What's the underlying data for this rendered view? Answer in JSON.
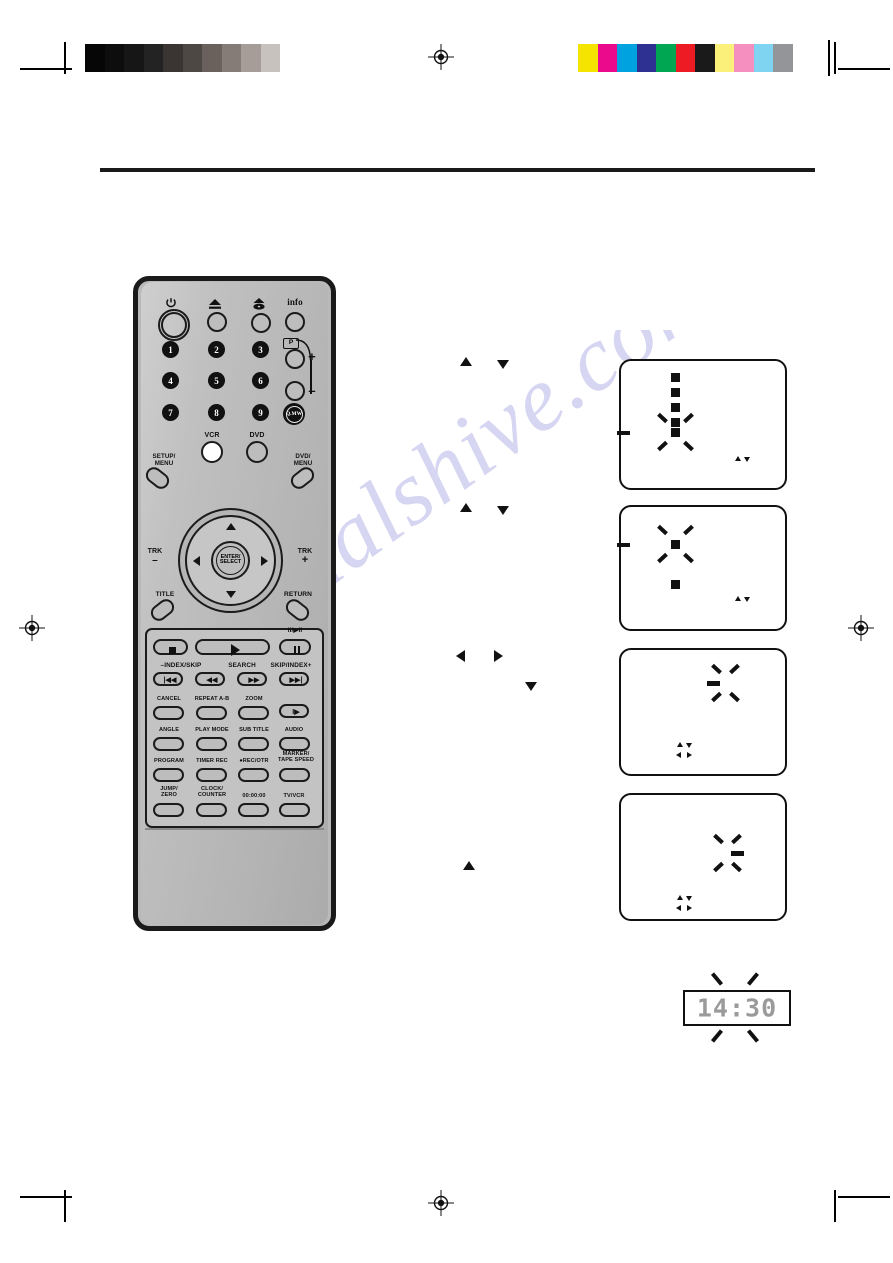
{
  "page": {
    "type": "scanned-manual-page",
    "watermark": "manualshive.com",
    "header_rule": true
  },
  "print_marks": {
    "grayscale_bar": [
      "#060606",
      "#0d0d0d",
      "#161616",
      "#232323",
      "#3a3533",
      "#4e4845",
      "#6a615c",
      "#867c77",
      "#a79d98",
      "#c8c2be",
      "#ffffff"
    ],
    "color_bar": [
      "#f5e400",
      "#ec0a8c",
      "#00a3e0",
      "#2e3192",
      "#00a651",
      "#ed1c24",
      "#1a1a1a",
      "#faf07a",
      "#f48fc0",
      "#7fd4f2",
      "#939598"
    ]
  },
  "remote": {
    "top_row": [
      {
        "name": "power",
        "icon": "power-icon",
        "label": ""
      },
      {
        "name": "vcr-eject",
        "icon": "eject-icon",
        "label": ""
      },
      {
        "name": "dvd-eject",
        "icon": "disc-eject-icon",
        "label": ""
      },
      {
        "name": "info",
        "icon": "",
        "label": "info"
      }
    ],
    "numbers": [
      "1",
      "2",
      "3",
      "4",
      "5",
      "6",
      "7",
      "8",
      "9"
    ],
    "channel": {
      "marker": "P",
      "plus": "+",
      "minus": "–"
    },
    "qmw_label": "Q.MW",
    "source_buttons": [
      {
        "name": "vcr",
        "label": "VCR"
      },
      {
        "name": "dvd",
        "label": "DVD"
      }
    ],
    "menu_buttons": [
      {
        "name": "setup-menu",
        "label": "SETUP/\nMENU"
      },
      {
        "name": "dvd-menu",
        "label": "DVD/\nMENU"
      },
      {
        "name": "title",
        "label": "TITLE"
      },
      {
        "name": "return",
        "label": "RETURN"
      }
    ],
    "trk_left": {
      "label": "TRK",
      "sign": "–"
    },
    "trk_right": {
      "label": "TRK",
      "sign": "+"
    },
    "enter_label": "ENTER/\nSELECT",
    "transport": {
      "stop": "■",
      "play": "▶",
      "pause_label": "II/▶II",
      "pause": "II"
    },
    "skip_row_labels": {
      "left": "–INDEX/SKIP",
      "center": "SEARCH",
      "right": "SKIP/INDEX+"
    },
    "skip_buttons": [
      "|◀◀",
      "◀◀",
      "▶▶",
      "▶▶|"
    ],
    "func_row_1": [
      "CANCEL",
      "REPEAT A-B",
      "ZOOM"
    ],
    "slow_button": "I▶",
    "func_row_2": [
      "ANGLE",
      "PLAY MODE",
      "SUB TITLE",
      "AUDIO"
    ],
    "func_row_3": [
      "PROGRAM",
      "TIMER REC",
      "●REC/OTR",
      "MARKER/\nTAPE SPEED"
    ],
    "func_row_4": [
      "JUMP/\nZERO",
      "CLOCK/\nCOUNTER",
      "00:00:00",
      "TV/VCR"
    ]
  },
  "steps": [
    {
      "id": "step-1",
      "cues": [
        "▲",
        "▼"
      ],
      "screen": {
        "name": "osd-screen-1",
        "description": "vertical dotted column with blinking block near bottom",
        "blink_indicator": "▲▼"
      }
    },
    {
      "id": "step-2",
      "cues": [
        "▲",
        "▼"
      ],
      "screen": {
        "name": "osd-screen-2",
        "description": "blinking block top-left with static block below",
        "blink_indicator": "▲▼"
      }
    },
    {
      "id": "step-3",
      "cues": [
        "◀",
        "▶",
        "▼"
      ],
      "screen": {
        "name": "osd-screen-3",
        "description": "blinking dash near top-right",
        "blink_indicator": "▲▼◀▶"
      }
    },
    {
      "id": "step-4",
      "cues": [
        "▲"
      ],
      "screen": {
        "name": "osd-screen-4",
        "description": "blinking dash at right side",
        "blink_indicator": "▲▼◀▶"
      }
    }
  ],
  "clock_display": {
    "name": "clock-lcd",
    "value": "14:30",
    "blinking": true
  }
}
